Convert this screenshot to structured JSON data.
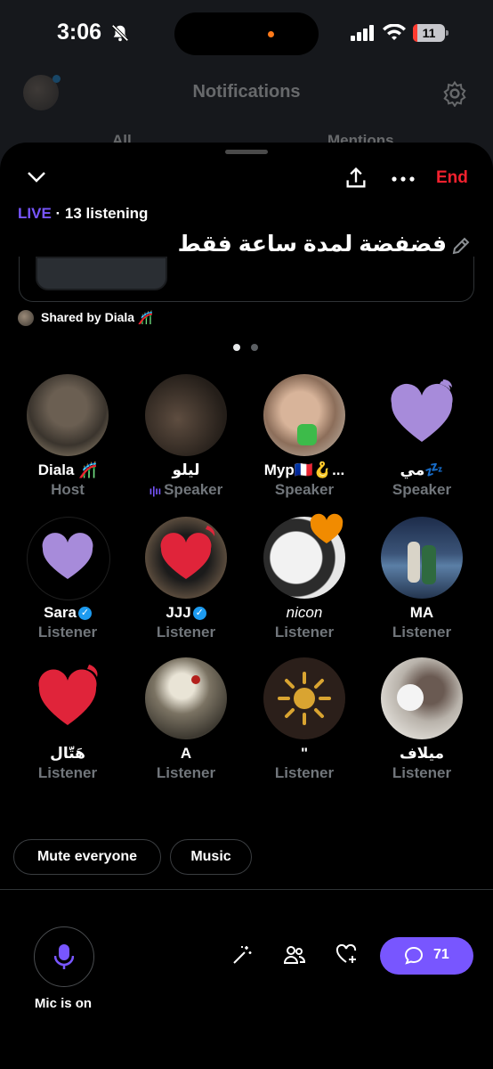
{
  "status_bar": {
    "time": "3:06",
    "battery": "11"
  },
  "background": {
    "title": "Notifications",
    "tabs": [
      "All",
      "Mentions"
    ]
  },
  "space": {
    "end_label": "End",
    "live_label": "LIVE",
    "listening": " · 13 listening",
    "title": "فضفضة لمدة ساعة فقط",
    "shared_by": "Shared by Diala 🎢"
  },
  "participants": [
    {
      "name": "Diala 🎢",
      "role": "Host"
    },
    {
      "name": "ليلو",
      "role": "Speaker"
    },
    {
      "name": "Myp🇫🇷🪝...",
      "role": "Speaker"
    },
    {
      "name": "مي💤",
      "role": "Speaker"
    },
    {
      "name": "Sara",
      "role": "Listener"
    },
    {
      "name": "JJJ",
      "role": "Listener"
    },
    {
      "name": "nicon",
      "role": "Listener"
    },
    {
      "name": "MA",
      "role": "Listener"
    },
    {
      "name": "هَتّال",
      "role": "Listener"
    },
    {
      "name": "A",
      "role": "Listener"
    },
    {
      "name": "\"",
      "role": "Listener"
    },
    {
      "name": "ميلاف",
      "role": "Listener"
    }
  ],
  "actions": {
    "mute_everyone": "Mute everyone",
    "music": "Music"
  },
  "mic": {
    "label": "Mic is on"
  },
  "chat": {
    "count": "71"
  },
  "colors": {
    "accent": "#7856ff",
    "end": "#f4212e",
    "muted_text": "#71767b",
    "heart_purple": "#a78bda",
    "heart_red": "#e0243a",
    "heart_orange": "#f18b00",
    "verified": "#1d9bf0"
  },
  "icons": [
    "bell-slash-icon",
    "signal-icon",
    "wifi-icon",
    "battery-icon",
    "gear-icon",
    "chevron-down-icon",
    "share-icon",
    "more-icon",
    "pencil-icon",
    "heart-icon",
    "microphone-icon",
    "magic-wand-icon",
    "people-icon",
    "heart-plus-icon",
    "chat-bubble-icon"
  ]
}
